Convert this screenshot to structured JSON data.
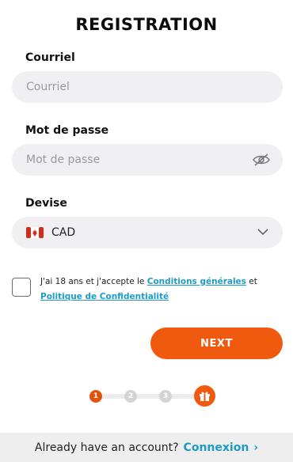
{
  "title": "REGISTRATION",
  "email": {
    "label": "Courriel",
    "placeholder": "Courriel"
  },
  "password": {
    "label": "Mot de passe",
    "placeholder": "Mot de passe"
  },
  "currency": {
    "label": "Devise",
    "value": "CAD",
    "flag_icon": "canada-flag-icon"
  },
  "terms": {
    "prefix": "J'ai 18 ans et j'accepte le ",
    "conditions_link": "Conditions générales",
    "middle": " et ",
    "privacy_link": "Politique de Confidentialité",
    "checked": false
  },
  "next_button": "NEXT",
  "steps": {
    "items": [
      "1",
      "2",
      "3"
    ],
    "current": 1,
    "final_icon": "gift-icon"
  },
  "footer": {
    "text": "Already have an account?",
    "link": "Connexion",
    "arrow": "›"
  },
  "colors": {
    "accent": "#ef5a0f",
    "link": "#1e9ac6",
    "field_bg": "#f0f0f2"
  }
}
